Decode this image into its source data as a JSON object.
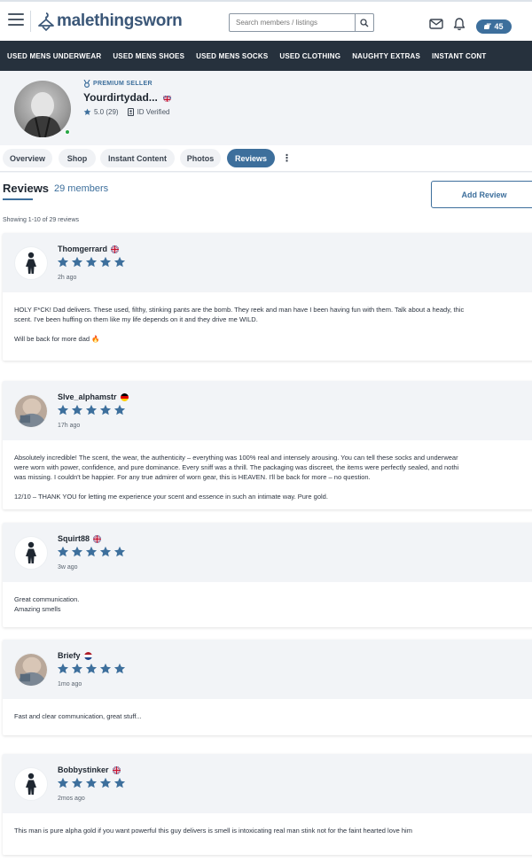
{
  "header": {
    "logo_text": "malethingsworn",
    "search_placeholder": "Search members / listings",
    "credits": "45"
  },
  "categories": [
    "USED MENS UNDERWEAR",
    "USED MENS SHOES",
    "USED MENS SOCKS",
    "USED CLOTHING",
    "NAUGHTY EXTRAS",
    "INSTANT CONT"
  ],
  "profile": {
    "badge": "PREMIUM SELLER",
    "username": "Yourdirtydad...",
    "rating": "5.0 (29)",
    "verified": "ID Verified"
  },
  "tabs": [
    "Overview",
    "Shop",
    "Instant Content",
    "Photos",
    "Reviews"
  ],
  "reviews_section": {
    "title": "Reviews",
    "count": "29 members",
    "add_label": "Add Review",
    "showing": "Showing 1-10 of 29 reviews"
  },
  "colors": {
    "accent": "#3d6f9c",
    "nav_bg": "#26313d",
    "star": "#3d6f9c",
    "online": "#27a745"
  },
  "reviews": [
    {
      "name": "Thomgerrard",
      "flag": "uk",
      "rating": 5,
      "time": "2h ago",
      "avatar": "silhouette",
      "paragraphs": [
        "HOLY F*CK! Dad delivers. These used, filthy, stinking pants are the bomb. They reek and man have I been having fun with them. Talk about a heady, thic",
        "scent. I've been huffing on them like my life depends on it and they drive me WILD.",
        "Will be back for more dad 🔥"
      ]
    },
    {
      "name": "Slve_alphamstr",
      "flag": "de",
      "rating": 5,
      "time": "17h ago",
      "avatar": "photo",
      "paragraphs": [
        "Absolutely incredible! The scent, the wear, the authenticity – everything was 100% real and intensely arousing. You can tell these socks and underwear",
        "were worn with power, confidence, and pure dominance. Every sniff was a thrill. The packaging was discreet, the items were perfectly sealed, and nothi",
        "was missing. I couldn't be happier. For any true admirer of worn gear, this is HEAVEN. I'll be back for more – no question.",
        "12/10 – THANK YOU for letting me experience your scent and essence in such an intimate way. Pure gold."
      ]
    },
    {
      "name": "Squirt88",
      "flag": "uk",
      "rating": 5,
      "time": "3w ago",
      "avatar": "silhouette",
      "paragraphs": [
        "Great communication.",
        "Amazing smells"
      ]
    },
    {
      "name": "Briefy",
      "flag": "nl",
      "rating": 5,
      "time": "1mo ago",
      "avatar": "photo",
      "paragraphs": [
        "Fast and clear communication, great stuff..."
      ]
    },
    {
      "name": "Bobbystinker",
      "flag": "uk",
      "rating": 5,
      "time": "2mos ago",
      "avatar": "silhouette",
      "paragraphs": [
        "This man is pure alpha gold if you want powerful this guy delivers is smell is intoxicating real man stink not for the faint hearted love him"
      ]
    }
  ]
}
